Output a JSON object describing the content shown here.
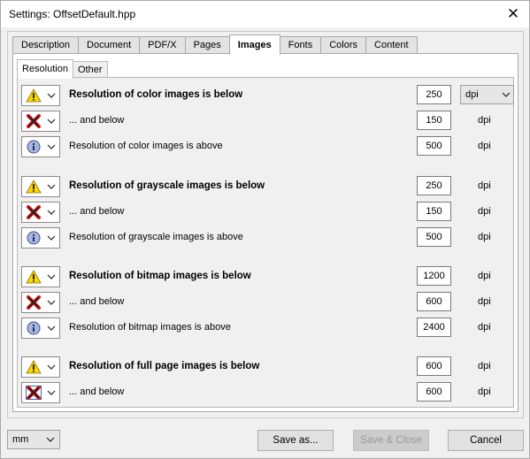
{
  "window": {
    "title": "Settings:  OffsetDefault.hpp",
    "close_glyph": "✕"
  },
  "tabs": [
    {
      "label": "Description"
    },
    {
      "label": "Document"
    },
    {
      "label": "PDF/X"
    },
    {
      "label": "Pages"
    },
    {
      "label": "Images",
      "active": true
    },
    {
      "label": "Fonts"
    },
    {
      "label": "Colors"
    },
    {
      "label": "Content"
    }
  ],
  "subtabs": [
    {
      "label": "Resolution",
      "active": true
    },
    {
      "label": "Other"
    }
  ],
  "unit_select": {
    "value": "dpi"
  },
  "rows": [
    {
      "severity": "warning",
      "label": "Resolution of color images is below",
      "bold": true,
      "value": "250",
      "unit": "dpi"
    },
    {
      "severity": "error",
      "label": "... and below",
      "bold": false,
      "value": "150",
      "unit": "dpi"
    },
    {
      "severity": "info",
      "label": "Resolution of color images is above",
      "bold": false,
      "value": "500",
      "unit": "dpi"
    },
    {
      "severity": "warning",
      "label": "Resolution of grayscale images is below",
      "bold": true,
      "value": "250",
      "unit": "dpi"
    },
    {
      "severity": "error",
      "label": "... and below",
      "bold": false,
      "value": "150",
      "unit": "dpi"
    },
    {
      "severity": "info",
      "label": "Resolution of grayscale images is above",
      "bold": false,
      "value": "500",
      "unit": "dpi"
    },
    {
      "severity": "warning",
      "label": "Resolution of bitmap images is below",
      "bold": true,
      "value": "1200",
      "unit": "dpi"
    },
    {
      "severity": "error",
      "label": "... and below",
      "bold": false,
      "value": "600",
      "unit": "dpi"
    },
    {
      "severity": "info",
      "label": "Resolution of bitmap images is above",
      "bold": false,
      "value": "2400",
      "unit": "dpi"
    },
    {
      "severity": "warning",
      "label": "Resolution of full page images is below",
      "bold": true,
      "value": "600",
      "unit": "dpi"
    },
    {
      "severity": "error-selected",
      "label": "... and below",
      "bold": false,
      "value": "600",
      "unit": "dpi"
    }
  ],
  "footer": {
    "unit_value": "mm",
    "save_as_label": "Save as...",
    "save_close_label": "Save & Close",
    "cancel_label": "Cancel"
  }
}
